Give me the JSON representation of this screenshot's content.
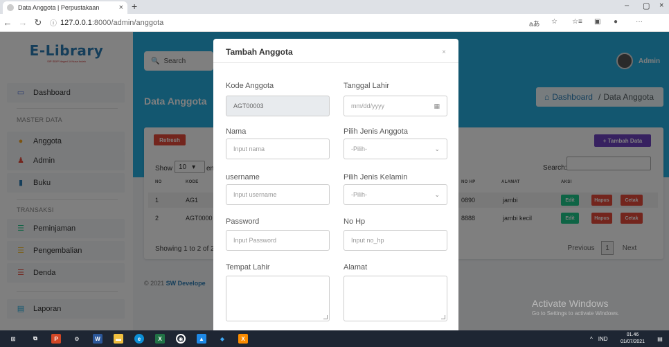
{
  "browser": {
    "tab_title": "Data Anggota | Perpustakaan",
    "tab_close": "×",
    "new_tab": "+",
    "url_host": "127.0.0.1",
    "url_path": ":8000/admin/anggota",
    "win_min": "–",
    "win_max": "▢",
    "win_close": "×"
  },
  "sidebar": {
    "brand": "E-Library",
    "brand_sub": "SIP SDIP Negeri 1t Nusa Indah",
    "dashboard": "Dashboard",
    "section_master": "MASTER DATA",
    "anggota": "Anggota",
    "admin": "Admin",
    "buku": "Buku",
    "section_transaksi": "TRANSAKSI",
    "peminjaman": "Peminjaman",
    "pengembalian": "Pengembalian",
    "denda": "Denda",
    "laporan": "Laporan"
  },
  "header": {
    "search_placeholder": "Search",
    "admin_label": "Admin",
    "page_title": "Data Anggota",
    "breadcrumb_home": "Dashboard",
    "breadcrumb_sep": "/",
    "breadcrumb_current": "Data Anggota"
  },
  "card": {
    "refresh": "Refresh",
    "tambah": "+ Tambah Data",
    "show_label": "Show",
    "show_value": "10",
    "entries_label": "ent",
    "search_label": "Search:",
    "columns": [
      "NO",
      "KODE",
      "NO HP",
      "ALAMAT",
      "AKSI"
    ],
    "rows": [
      {
        "no": "1",
        "kode": "AG1",
        "nohp": "0890",
        "alamat": "jambi"
      },
      {
        "no": "2",
        "kode": "AGT0000",
        "nohp": "8888",
        "alamat": "jambi kecil"
      }
    ],
    "btn_edit": "Edit",
    "btn_hapus": "Hapus",
    "btn_cetak": "Cetak",
    "info": "Showing 1 to 2 of 2",
    "previous": "Previous",
    "page": "1",
    "next": "Next"
  },
  "footer": {
    "copyright": "© 2021",
    "developer": "SW Develope"
  },
  "activate": {
    "title": "Activate Windows",
    "subtitle": "Go to Settings to activate Windows."
  },
  "modal": {
    "title": "Tambah Anggota",
    "close": "×",
    "kode_label": "Kode Anggota",
    "kode_value": "AGT00003",
    "tanggal_label": "Tanggal Lahir",
    "tanggal_placeholder": "mm/dd/yyyy",
    "nama_label": "Nama",
    "nama_placeholder": "Input nama",
    "jenis_anggota_label": "Pilih Jenis Anggota",
    "jenis_anggota_value": "-Pilih-",
    "username_label": "username",
    "username_placeholder": "Input username",
    "jenis_kelamin_label": "Pilih Jenis Kelamin",
    "jenis_kelamin_value": "-Pilih-",
    "password_label": "Password",
    "password_placeholder": "Input Password",
    "nohp_label": "No Hp",
    "nohp_placeholder": "Input no_hp",
    "tempat_label": "Tempat Lahir",
    "alamat_label": "Alamat"
  },
  "taskbar": {
    "lang": "IND",
    "time": "01.46",
    "date": "01/07/2021"
  },
  "colors": {
    "accent": "#26aee0",
    "brand": "#2a7cb5",
    "danger": "#e74a3b",
    "success": "#1cc88a",
    "purple": "#6f42c1"
  }
}
